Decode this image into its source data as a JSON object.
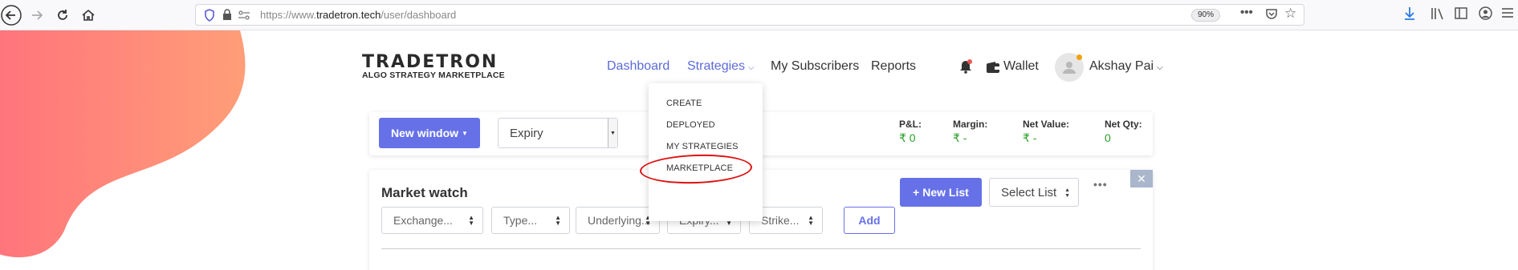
{
  "browser": {
    "url_prefix": "https://www.",
    "url_host": "tradetron.tech",
    "url_path": "/user/dashboard",
    "zoom": "90%"
  },
  "logo": {
    "name": "TRADETRON",
    "tagline": "ALGO STRATEGY MARKETPLACE"
  },
  "nav": {
    "dashboard": "Dashboard",
    "strategies": "Strategies",
    "my_subscribers": "My Subscribers",
    "reports": "Reports",
    "wallet": "Wallet",
    "user_name": "Akshay Pai"
  },
  "strategies_menu": [
    "CREATE",
    "DEPLOYED",
    "MY STRATEGIES",
    "MARKETPLACE"
  ],
  "toolbar": {
    "new_window": "New window",
    "expiry_select": "Expiry",
    "stats": [
      {
        "label": "P&L:",
        "value": "₹ 0"
      },
      {
        "label": "Margin:",
        "value": "₹ -"
      },
      {
        "label": "Net Value:",
        "value": "₹ -"
      },
      {
        "label": "Net Qty:",
        "value": "0"
      }
    ]
  },
  "market_watch": {
    "title": "Market watch",
    "new_list": "+ New List",
    "select_list": "Select List",
    "filters": [
      "Exchange...",
      "Type...",
      "Underlying...",
      "Expiry...",
      "Strike..."
    ],
    "add": "Add"
  },
  "colors": {
    "accent": "#6671e8",
    "positive": "#2a9d2a",
    "highlight": "#dd1111"
  }
}
